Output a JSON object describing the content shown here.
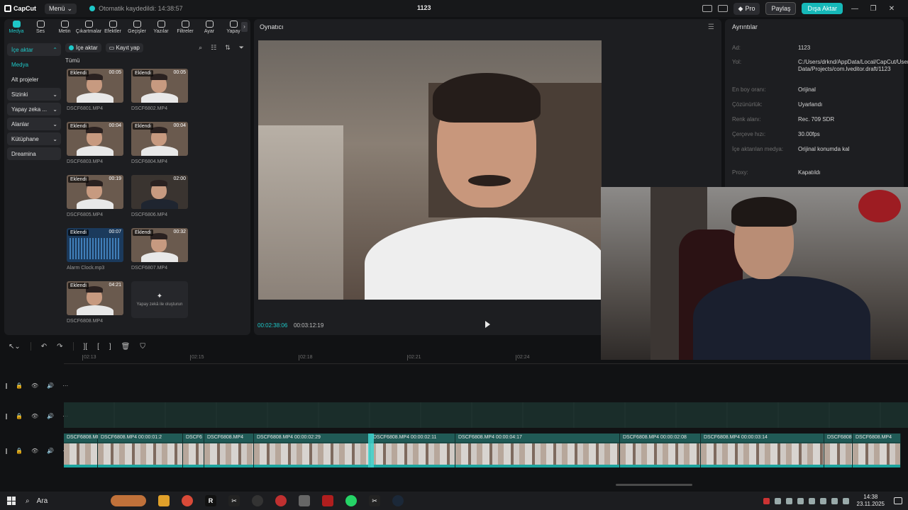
{
  "titlebar": {
    "logo": "CapCut",
    "menu_label": "Menü",
    "autosave_text": "Otomatik kaydedildi: 14:38:57",
    "project_title": "1123",
    "pro_label": "Pro",
    "share_label": "Paylaş",
    "export_label": "Dışa Aktar"
  },
  "tool_tabs": [
    {
      "label": "Medya",
      "icon": "media-icon"
    },
    {
      "label": "Ses",
      "icon": "audio-icon"
    },
    {
      "label": "Metin",
      "icon": "text-icon"
    },
    {
      "label": "Çıkartmalar",
      "icon": "sticker-icon"
    },
    {
      "label": "Efektler",
      "icon": "effects-icon"
    },
    {
      "label": "Geçişler",
      "icon": "transitions-icon"
    },
    {
      "label": "Yazılar",
      "icon": "captions-icon"
    },
    {
      "label": "Filtreler",
      "icon": "filters-icon"
    },
    {
      "label": "Ayar",
      "icon": "adjust-icon"
    },
    {
      "label": "Yapay",
      "icon": "ai-icon"
    }
  ],
  "side_nav": [
    {
      "label": "İçe aktar",
      "type": "section",
      "chevron": "⌃"
    },
    {
      "label": "Medya",
      "type": "sub-selected",
      "chevron": ""
    },
    {
      "label": "Alt projeler",
      "type": "item",
      "chevron": ""
    },
    {
      "label": "Sizinki",
      "type": "section",
      "chevron": "⌄"
    },
    {
      "label": "Yapay zeka ...",
      "type": "section",
      "chevron": "⌄"
    },
    {
      "label": "Alanlar",
      "type": "section",
      "chevron": "⌄"
    },
    {
      "label": "Kütüphane",
      "type": "section",
      "chevron": "⌄"
    },
    {
      "label": "Dreamina",
      "type": "section",
      "chevron": ""
    }
  ],
  "media": {
    "import_label": "İçe aktar",
    "record_label": "Kayıt yap",
    "filter_label": "Tümü",
    "items": [
      {
        "name": "DSCF6801.MP4",
        "badge": "Eklendi",
        "duration": "00:05",
        "kind": "light"
      },
      {
        "name": "DSCF6802.MP4",
        "badge": "Eklendi",
        "duration": "00:05",
        "kind": "light"
      },
      {
        "name": "DSCF6803.MP4",
        "badge": "Eklendi",
        "duration": "00:04",
        "kind": "light"
      },
      {
        "name": "DSCF6804.MP4",
        "badge": "Eklendi",
        "duration": "00:04",
        "kind": "light"
      },
      {
        "name": "DSCF6805.MP4",
        "badge": "Eklendi",
        "duration": "00:19",
        "kind": "light"
      },
      {
        "name": "DSCF6806.MP4",
        "badge": "",
        "duration": "02:00",
        "kind": "dark"
      },
      {
        "name": "Alarm Clock.mp3",
        "badge": "Eklendi",
        "duration": "00:07",
        "kind": "audio"
      },
      {
        "name": "DSCF6807.MP4",
        "badge": "Eklendi",
        "duration": "00:32",
        "kind": "light"
      },
      {
        "name": "DSCF6808.MP4",
        "badge": "Eklendi",
        "duration": "04:21",
        "kind": "light"
      }
    ],
    "ai_card_text": "Yapay zekâ ile oluşturun"
  },
  "player": {
    "title": "Oynatıcı",
    "current_time": "00:02:38:06",
    "total_time": "00:03:12:19"
  },
  "details": {
    "title": "Ayrıntılar",
    "rows": [
      {
        "label": "Ad:",
        "value": "1123"
      },
      {
        "label": "Yol:",
        "value": "C:/Users/drknd/AppData/Local/CapCut/User Data/Projects/com.lveditor.draft/1123"
      },
      {
        "label": "En boy oranı:",
        "value": "Orijinal"
      },
      {
        "label": "Çözünürlük:",
        "value": "Uyarlandı"
      },
      {
        "label": "Renk alanı:",
        "value": "Rec. 709 SDR"
      },
      {
        "label": "Çerçeve hızı:",
        "value": "30.00fps"
      },
      {
        "label": "İçe aktarılan medya:",
        "value": "Orijinal konumda kal"
      },
      {
        "label": "Proxy:",
        "value": "Kapatıldı"
      }
    ]
  },
  "timeline": {
    "ruler_ticks": [
      "02:13",
      "02:15",
      "02:18",
      "02:21",
      "02:24"
    ],
    "clips": [
      {
        "label": "DSCF6808.MP",
        "duration": ""
      },
      {
        "label": "DSCF6808.MP4",
        "duration": "00:00:01:2"
      },
      {
        "label": "DSCF6",
        "duration": ""
      },
      {
        "label": "DSCF6808.MP4",
        "duration": ""
      },
      {
        "label": "DSCF6808.MP4",
        "duration": "00:00:02:29"
      },
      {
        "label": "DSCF6808.MP4",
        "duration": "00:00:02:11"
      },
      {
        "label": "DSCF6808.MP4",
        "duration": "00:00:04:17"
      },
      {
        "label": "DSCF6808.MP4",
        "duration": "00:00:02:08"
      },
      {
        "label": "DSCF6808.MP4",
        "duration": "00:00:03:14"
      },
      {
        "label": "DSCF6808",
        "duration": ""
      },
      {
        "label": "DSCF6808.MP4",
        "duration": ""
      }
    ]
  },
  "taskbar": {
    "search_label": "Ara",
    "time": "14:38",
    "date": "23.11.2025"
  },
  "colors": {
    "accent": "#1ec8c8",
    "track": "#1a4a46"
  }
}
